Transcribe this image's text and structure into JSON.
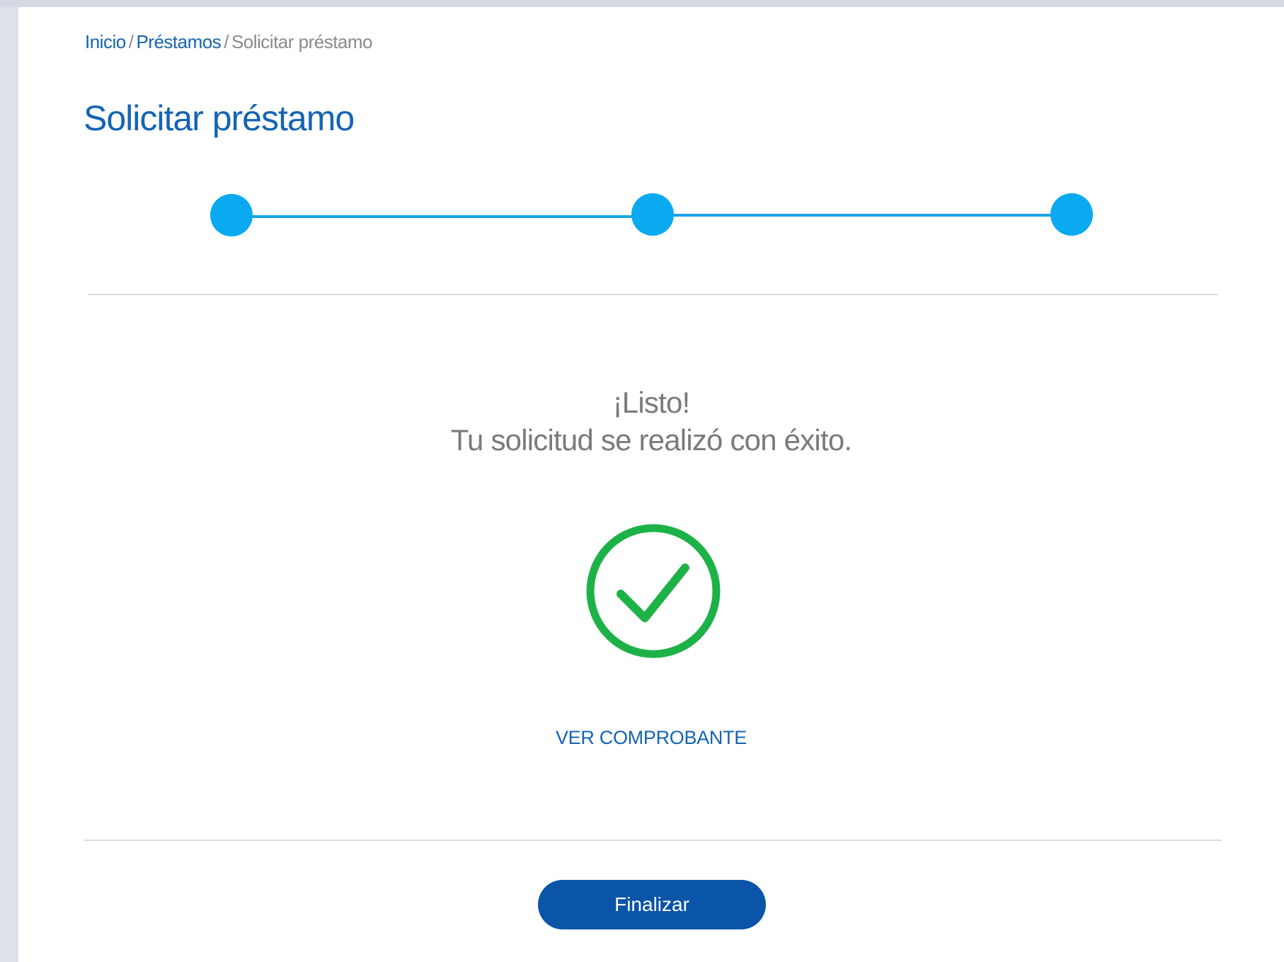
{
  "breadcrumb": {
    "home": "Inicio",
    "separator": "/",
    "loans": "Préstamos",
    "current": "Solicitar préstamo"
  },
  "page_title": "Solicitar préstamo",
  "stepper": {
    "total_steps": 3,
    "completed_steps": 3,
    "color": "#0aaaf0"
  },
  "success": {
    "title": "¡Listo!",
    "message": "Tu solicitud se realizó con éxito.",
    "icon": "check-circle-icon",
    "icon_color": "#1db247"
  },
  "receipt_link": "VER COMPROBANTE",
  "finish_button": "Finalizar",
  "colors": {
    "primary": "#1464b4",
    "button": "#0a55a8",
    "text_muted": "#7a7a7a"
  }
}
